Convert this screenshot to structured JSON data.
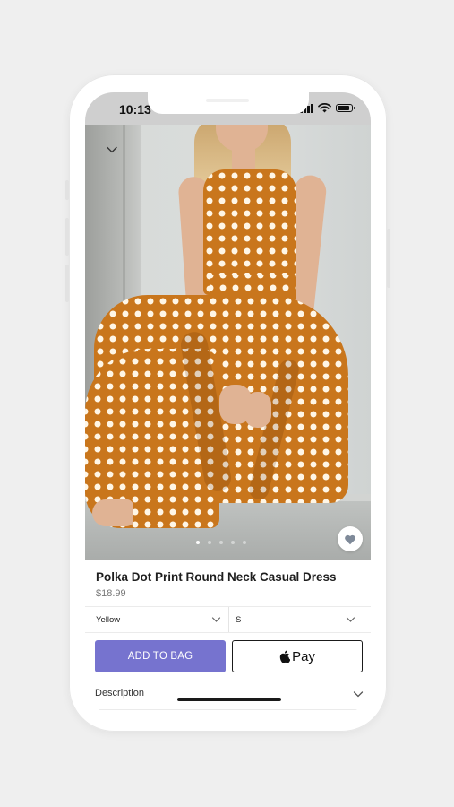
{
  "status_bar": {
    "time": "10:13"
  },
  "product": {
    "title": "Polka Dot Print Round Neck Casual Dress",
    "price": "$18.99",
    "image_icon": "dress-photo",
    "carousel": {
      "total": 5,
      "active": 1
    }
  },
  "options": {
    "color_value": "Yellow",
    "size_value": "S"
  },
  "actions": {
    "add_to_bag": "ADD TO BAG",
    "pay_label": "Pay"
  },
  "sections": {
    "description": "Description"
  },
  "colors": {
    "accent": "#7673cf",
    "dress": "#c9761c",
    "status_bar": "#cfcfcf"
  },
  "icons": [
    "chevron-down-icon",
    "heart-icon",
    "apple-logo-icon",
    "wifi-icon",
    "signal-icon",
    "battery-icon"
  ]
}
